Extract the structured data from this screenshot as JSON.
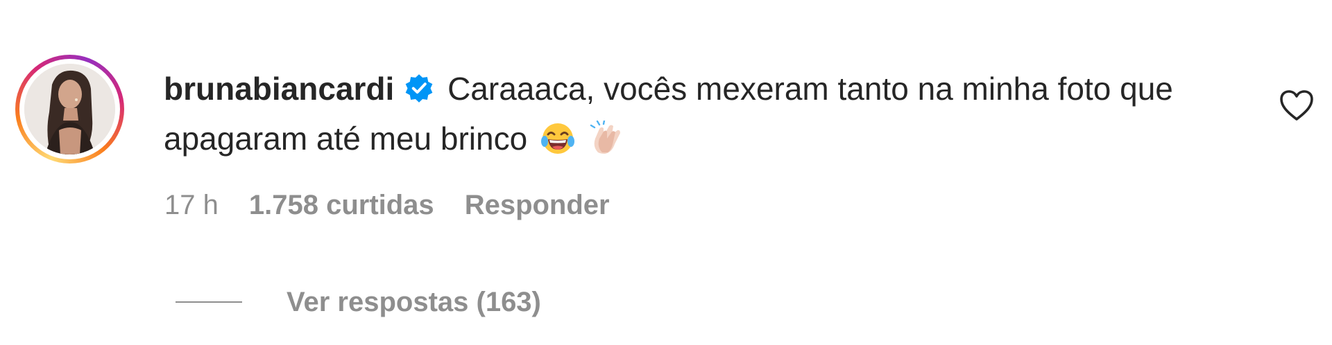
{
  "comment": {
    "username": "brunabiancardi",
    "verified_icon": "verified-badge-icon",
    "text": "Caraaaca, vocês mexeram tanto na minha foto que apagaram até meu brinco",
    "emojis": [
      "tears-of-joy-emoji",
      "clapping-hands-emoji"
    ],
    "avatar_icon": "profile-photo",
    "like_icon": "heart-outline-icon",
    "meta": {
      "time": "17 h",
      "likes": "1.758 curtidas",
      "reply": "Responder"
    },
    "view_replies": "Ver respostas (163)"
  },
  "colors": {
    "text": "#262626",
    "secondary": "#8e8e8e",
    "verified": "#0095f6"
  }
}
